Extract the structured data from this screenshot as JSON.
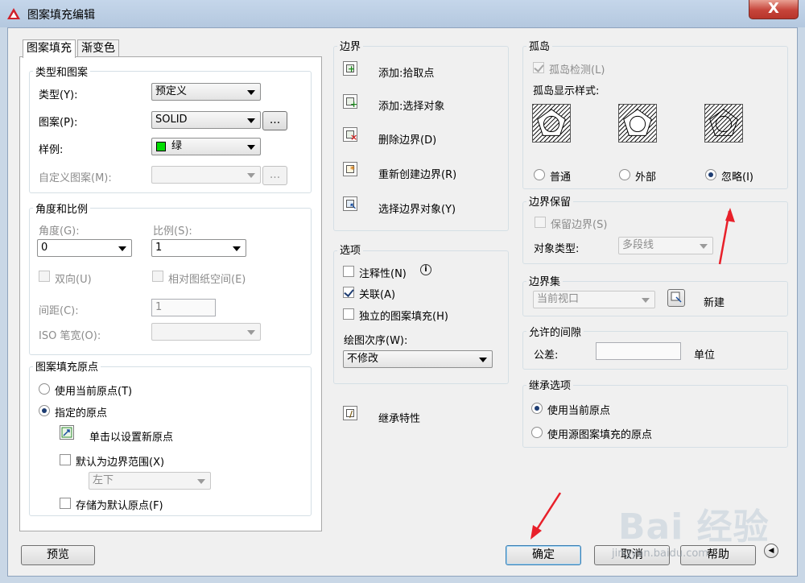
{
  "window": {
    "title": "图案填充编辑",
    "close_label": "X"
  },
  "tabs": [
    {
      "label": "图案填充",
      "active": true
    },
    {
      "label": "渐变色",
      "active": false
    }
  ],
  "type_pattern": {
    "title": "类型和图案",
    "type_label": "类型(Y):",
    "type_value": "预定义",
    "pattern_label": "图案(P):",
    "pattern_value": "SOLID",
    "browse_label": "...",
    "sample_label": "样例:",
    "sample_value": "绿",
    "sample_color": "#00dd00",
    "custom_label": "自定义图案(M):",
    "custom_value": "",
    "custom_browse_label": "..."
  },
  "angle_scale": {
    "title": "角度和比例",
    "angle_label": "角度(G):",
    "angle_value": "0",
    "scale_label": "比例(S):",
    "scale_value": "1",
    "double_label": "双向(U)",
    "relative_label": "相对图纸空间(E)",
    "spacing_label": "间距(C):",
    "spacing_value": "1",
    "iso_label": "ISO 笔宽(O):",
    "iso_value": ""
  },
  "origin": {
    "title": "图案填充原点",
    "current_label": "使用当前原点(T)",
    "specified_label": "指定的原点",
    "click_set_label": "单击以设置新原点",
    "default_extent_label": "默认为边界范围(X)",
    "extent_value": "左下",
    "store_default_label": "存储为默认原点(F)"
  },
  "boundary": {
    "title": "边界",
    "add_pick_label": "添加:拾取点",
    "add_select_label": "添加:选择对象",
    "remove_label": "删除边界(D)",
    "recreate_label": "重新创建边界(R)",
    "view_selection_label": "选择边界对象(Y)"
  },
  "options": {
    "title": "选项",
    "annotative_label": "注释性(N)",
    "annotative_info": "i",
    "associative_label": "关联(A)",
    "separate_label": "独立的图案填充(H)",
    "draw_order_label": "绘图次序(W):",
    "draw_order_value": "不修改"
  },
  "inherit": {
    "label": "继承特性"
  },
  "islands": {
    "title": "孤岛",
    "detect_label": "孤岛检测(L)",
    "style_label": "孤岛显示样式:",
    "normal_label": "普通",
    "outer_label": "外部",
    "ignore_label": "忽略(I)"
  },
  "retain": {
    "title": "边界保留",
    "retain_label": "保留边界(S)",
    "object_type_label": "对象类型:",
    "object_type_value": "多段线"
  },
  "boundary_set": {
    "title": "边界集",
    "value": "当前视口",
    "new_label": "新建"
  },
  "gap": {
    "title": "允许的间隙",
    "tolerance_label": "公差:",
    "tolerance_value": "",
    "unit_label": "单位"
  },
  "inherit_options": {
    "title": "继承选项",
    "use_current_label": "使用当前原点",
    "use_source_label": "使用源图案填充的原点"
  },
  "footer": {
    "preview_label": "预览",
    "ok_label": "确定",
    "cancel_label": "取消",
    "help_label": "帮助",
    "expand_label": "◀"
  },
  "watermark": {
    "brand": "Bai 经验",
    "url": "jingyan.baidu.com"
  }
}
